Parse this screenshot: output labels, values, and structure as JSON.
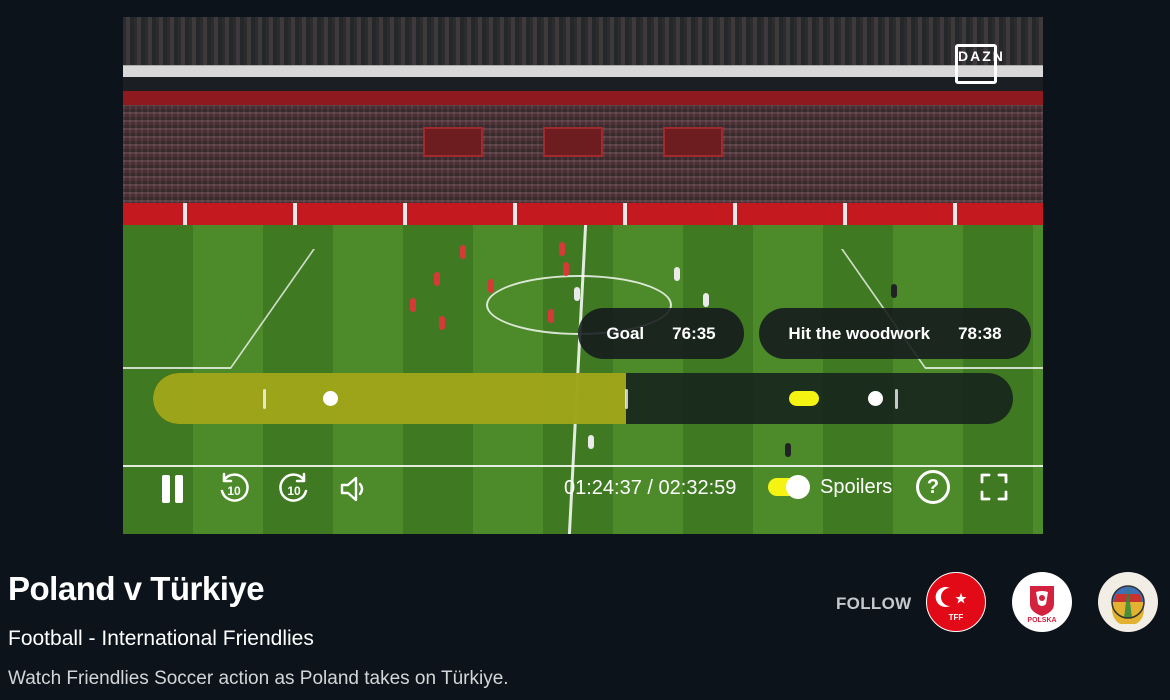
{
  "player": {
    "logo": "DAZN",
    "events": [
      {
        "label": "Goal",
        "time": "76:35"
      },
      {
        "label": "Hit the woodwork",
        "time": "78:38"
      }
    ],
    "progress_fraction": 0.55,
    "time_display": "01:24:37 / 02:32:59",
    "spoilers_label": "Spoilers",
    "spoilers_on": true,
    "seek_back_seconds": "10",
    "seek_forward_seconds": "10",
    "help_glyph": "?",
    "accent_color": "#f4f311"
  },
  "event": {
    "title": "Poland v Türkiye",
    "subtitle": "Football - International Friendlies",
    "description": "Watch Friendlies Soccer action as Poland takes on Türkiye."
  },
  "follow": {
    "label": "FOLLOW",
    "teams": [
      {
        "name": "TFF",
        "icon": "turkey-federation-crest"
      },
      {
        "name": "POLSKA",
        "icon": "poland-federation-crest"
      },
      {
        "name": "",
        "icon": "international-friendlies-emblem"
      }
    ]
  },
  "icons": {
    "pause": "pause-icon",
    "rewind": "rewind-10-icon",
    "forward": "forward-10-icon",
    "volume": "volume-icon",
    "help": "help-icon",
    "fullscreen": "fullscreen-icon"
  }
}
